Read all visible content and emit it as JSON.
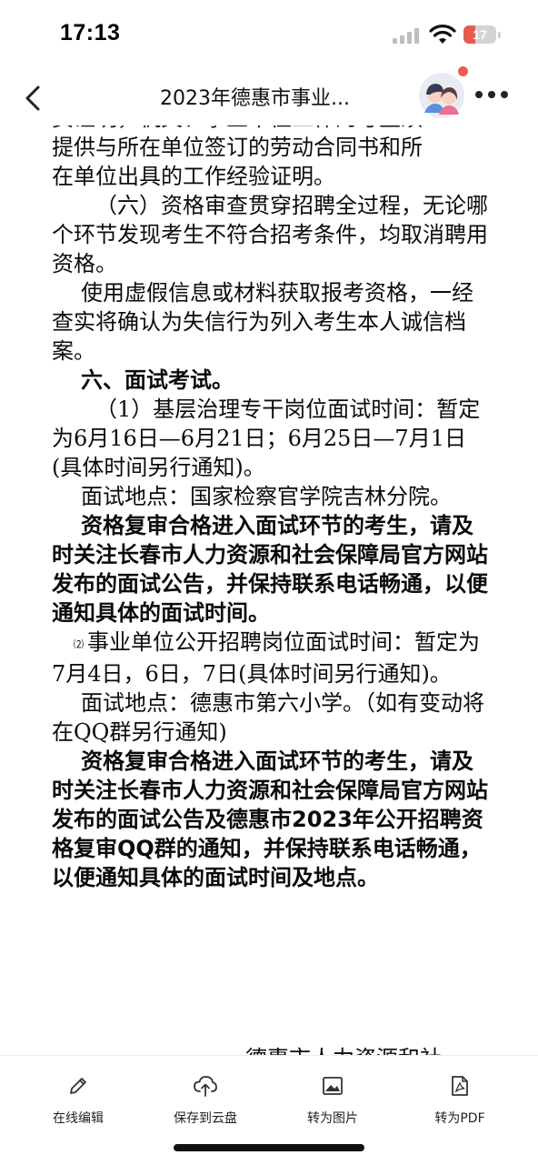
{
  "status_bar": {
    "time": "17:13",
    "battery_level": "17"
  },
  "nav": {
    "title": "2023年德惠市事业..."
  },
  "document": {
    "lines": [
      "提供与所在单位签订的劳动合同书和所",
      "在单位出具的工作经验证明。",
      "（六）资格审查贯穿招聘全过程，无论哪个环节发现考生不符合招考条件，均取消聘用资格。",
      "使用虚假信息或材料获取报考资格，一经查实将确认为失信行为列入考生本人诚信档案。",
      "六、面试考试。",
      "（1）基层治理专干岗位面试时间：暂定为6月16日—6月21日；6月25日—7月1日(具体时间另行通知)。",
      "面试地点：国家检察官学院吉林分院。",
      "资格复审合格进入面试环节的考生，请及时关注长春市人力资源和社会保障局官方网站发布的面试公告，并保持联系电话畅通，以便通知具体的面试时间。",
      "⑵",
      "事业单位公开招聘岗位面试时间：暂定为7月4日，6日，7日(具体时间另行通知)。",
      "面试地点：德惠市第六小学。（如有变动将在QQ群另行通知)",
      "资格复审合格进入面试环节的考生，请及时关注长春市人力资源和社会保障局官方网站发布的面试公告及德惠市2023年公开招聘资格复审QQ群的通知，并保持联系电话畅通，以便通知具体的面试时间及地点。"
    ],
    "signature_partial": "德惠市人力资源和社"
  },
  "toolbar": {
    "items": [
      {
        "label": "在线编辑",
        "icon": "pencil-icon"
      },
      {
        "label": "保存到云盘",
        "icon": "cloud-upload-icon"
      },
      {
        "label": "转为图片",
        "icon": "image-icon"
      },
      {
        "label": "转为PDF",
        "icon": "pdf-icon"
      }
    ]
  },
  "colors": {
    "notification": "#ef5b4c",
    "battery_low": "#e65b4f"
  }
}
